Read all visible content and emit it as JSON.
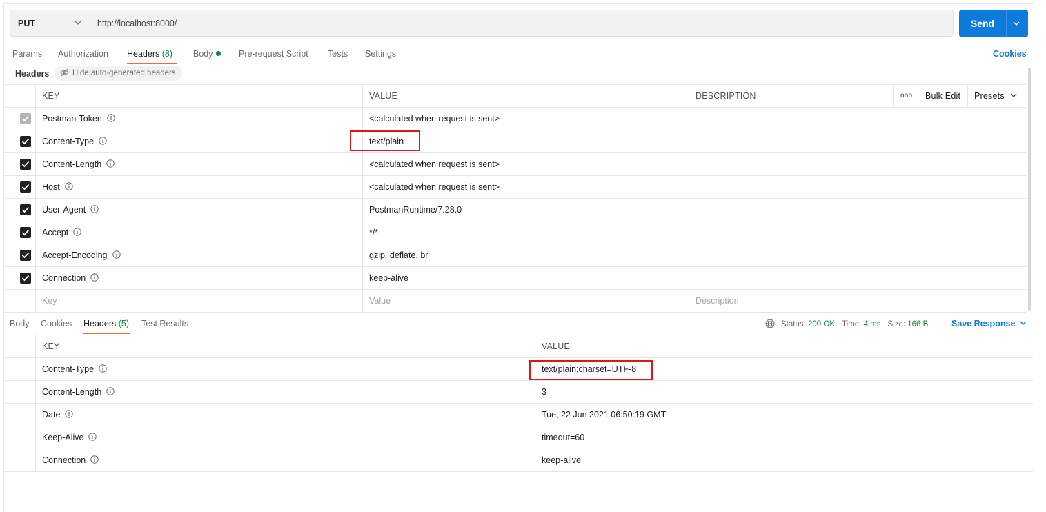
{
  "request": {
    "method": "PUT",
    "url": "http://localhost:8000/",
    "send_label": "Send"
  },
  "request_tabs": {
    "params": "Params",
    "authorization": "Authorization",
    "headers": "Headers",
    "headers_count": "(8)",
    "body": "Body",
    "prerequest": "Pre-request Script",
    "tests": "Tests",
    "settings": "Settings",
    "cookies": "Cookies"
  },
  "headers_section": {
    "label": "Headers",
    "hide_button": "Hide auto-generated headers"
  },
  "request_headers": {
    "columns": {
      "key": "KEY",
      "value": "VALUE",
      "description": "DESCRIPTION",
      "more": "ooo",
      "bulk_edit": "Bulk Edit",
      "presets": "Presets"
    },
    "rows": [
      {
        "key": "Postman-Token",
        "value": "<calculated when request is sent>",
        "checked": true,
        "disabled": true
      },
      {
        "key": "Content-Type",
        "value": "text/plain",
        "checked": true,
        "disabled": false
      },
      {
        "key": "Content-Length",
        "value": "<calculated when request is sent>",
        "checked": true,
        "disabled": false
      },
      {
        "key": "Host",
        "value": "<calculated when request is sent>",
        "checked": true,
        "disabled": false
      },
      {
        "key": "User-Agent",
        "value": "PostmanRuntime/7.28.0",
        "checked": true,
        "disabled": false
      },
      {
        "key": "Accept",
        "value": "*/*",
        "checked": true,
        "disabled": false
      },
      {
        "key": "Accept-Encoding",
        "value": "gzip, deflate, br",
        "checked": true,
        "disabled": false
      },
      {
        "key": "Connection",
        "value": "keep-alive",
        "checked": true,
        "disabled": false
      }
    ],
    "new_row": {
      "key_placeholder": "Key",
      "value_placeholder": "Value",
      "description_placeholder": "Description"
    }
  },
  "response_tabs": {
    "body": "Body",
    "cookies": "Cookies",
    "headers": "Headers",
    "headers_count": "(5)",
    "test_results": "Test Results"
  },
  "response_status": {
    "status_label": "Status:",
    "status_value": "200 OK",
    "time_label": "Time:",
    "time_value": "4 ms",
    "size_label": "Size:",
    "size_value": "166 B",
    "save_response": "Save Response"
  },
  "response_headers": {
    "columns": {
      "key": "KEY",
      "value": "VALUE"
    },
    "rows": [
      {
        "key": "Content-Type",
        "value": "text/plain;charset=UTF-8"
      },
      {
        "key": "Content-Length",
        "value": "3"
      },
      {
        "key": "Date",
        "value": "Tue, 22 Jun 2021 06:50:19 GMT"
      },
      {
        "key": "Keep-Alive",
        "value": "timeout=60"
      },
      {
        "key": "Connection",
        "value": "keep-alive"
      }
    ]
  },
  "colors": {
    "accent_blue": "#0c7bdc",
    "tab_underline": "#f26b3a",
    "success_green": "#0f8a3e",
    "highlight_red": "#e11717"
  }
}
